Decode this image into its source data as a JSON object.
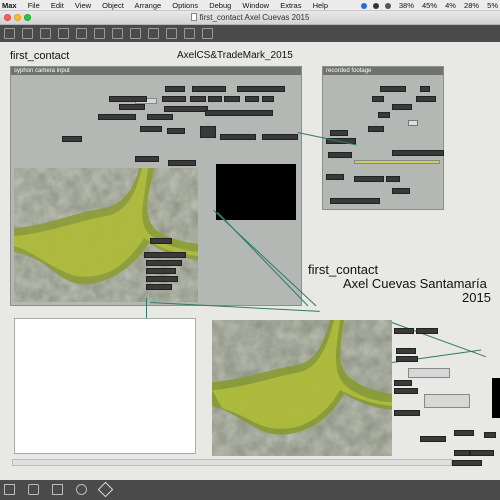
{
  "menubar": {
    "items": [
      "Max",
      "File",
      "Edit",
      "View",
      "Object",
      "Arrange",
      "Options",
      "Debug",
      "Window",
      "Extras",
      "Help"
    ],
    "status": [
      "38%",
      "45%",
      "4%",
      "28%",
      "5%"
    ]
  },
  "window": {
    "title": "first_contact Axel Cuevas 2015"
  },
  "patch": {
    "header_left": "first_contact",
    "header_right": "AxelCS&TradeMark_2015",
    "syphon_title": "syphon camera input",
    "recorded_title": "recorded footage",
    "credit_line1": "first_contact",
    "credit_line2": "Axel Cuevas Santamaría",
    "credit_line3": "2015"
  },
  "colors": {
    "cord": "#2e7a6a",
    "subpatch_bg": "#b4b8b4",
    "toolbar_bg": "#4b4b4b"
  }
}
